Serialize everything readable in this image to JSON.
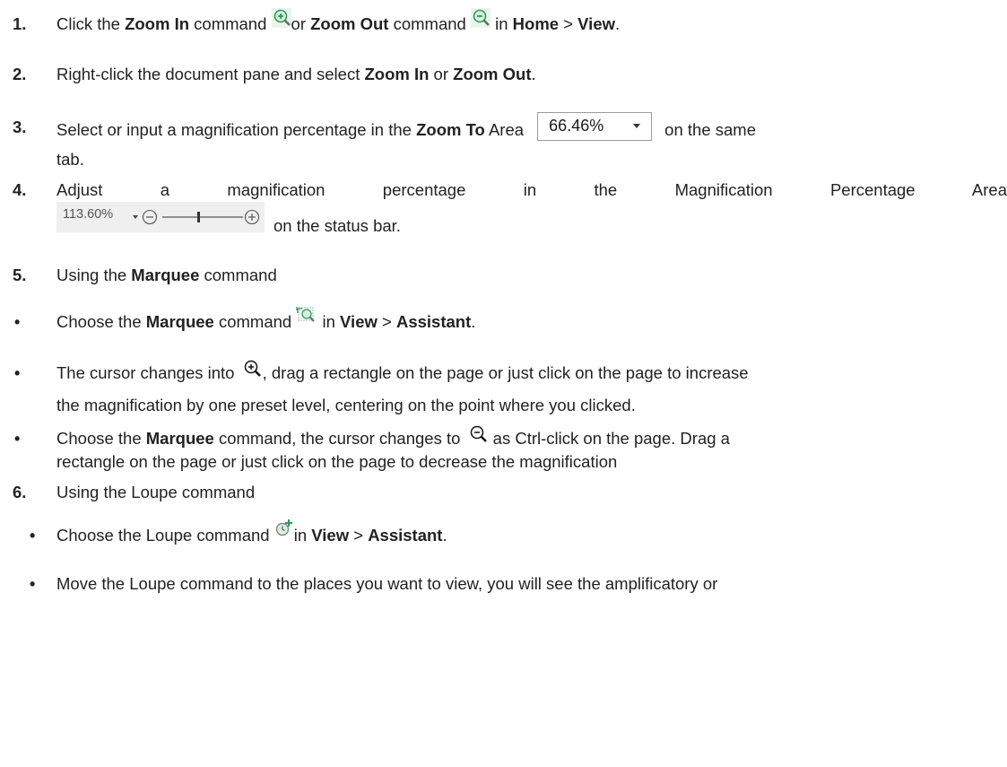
{
  "steps": [
    {
      "number": "1.",
      "parts": [
        "Click the ",
        "Zoom In",
        " command ",
        "or ",
        "Zoom Out",
        " command ",
        " in ",
        "Home",
        " > ",
        "View",
        "."
      ]
    },
    {
      "number": "2.",
      "parts": [
        "Right-click the document pane and select ",
        "Zoom In",
        " or ",
        "Zoom Out",
        "."
      ]
    },
    {
      "number": "3.",
      "parts": [
        "Select or input a magnification percentage in the ",
        "Zoom To",
        " Area ",
        "on the same"
      ],
      "zoom_value": "66.46%",
      "continuation": "tab."
    },
    {
      "number": "4.",
      "line1": "Adjust a magnification percentage in the Magnification Percentage Area",
      "mag_value": "113.60%",
      "slider_level_percent": 45,
      "continuation": "on the status bar."
    },
    {
      "number": "5.",
      "parts": [
        "Using the ",
        "Marquee",
        " command"
      ]
    },
    {
      "number": "6.",
      "text": "Using the Loupe command"
    }
  ],
  "bullets": [
    {
      "symbol": "•",
      "parts": [
        "Choose the ",
        "Marquee",
        " command ",
        " in ",
        "View",
        " > ",
        "Assistant",
        "."
      ]
    },
    {
      "symbol": "•",
      "parts": [
        "The cursor changes into ",
        ", drag a rectangle on the page or just click on the page to increase"
      ],
      "continuation": "the magnification by one preset level, centering on the point where you clicked."
    },
    {
      "symbol": "•",
      "parts": [
        "Choose the ",
        "Marquee",
        " command, the cursor changes to ",
        " as Ctrl-click on the page. Drag a"
      ],
      "continuation": "rectangle on the page or just click on the page to decrease the magnification"
    },
    {
      "symbol": "•",
      "parts": [
        "Choose the Loupe command ",
        "in ",
        "View",
        " > ",
        "Assistant",
        "."
      ]
    },
    {
      "symbol": "•",
      "text": "Move the Loupe command to the places you want to view, you will see the amplificatory or"
    }
  ],
  "icons": {
    "zoom_in": "zoom-in-icon",
    "zoom_out": "zoom-out-icon",
    "marquee": "marquee-zoom-icon",
    "cursor_in": "zoom-in-cursor-icon",
    "cursor_out": "zoom-out-cursor-icon",
    "loupe": "loupe-icon"
  },
  "colors": {
    "text": "#222222",
    "icon_green": "#2e9c57",
    "icon_bg": "#d9f0df"
  }
}
